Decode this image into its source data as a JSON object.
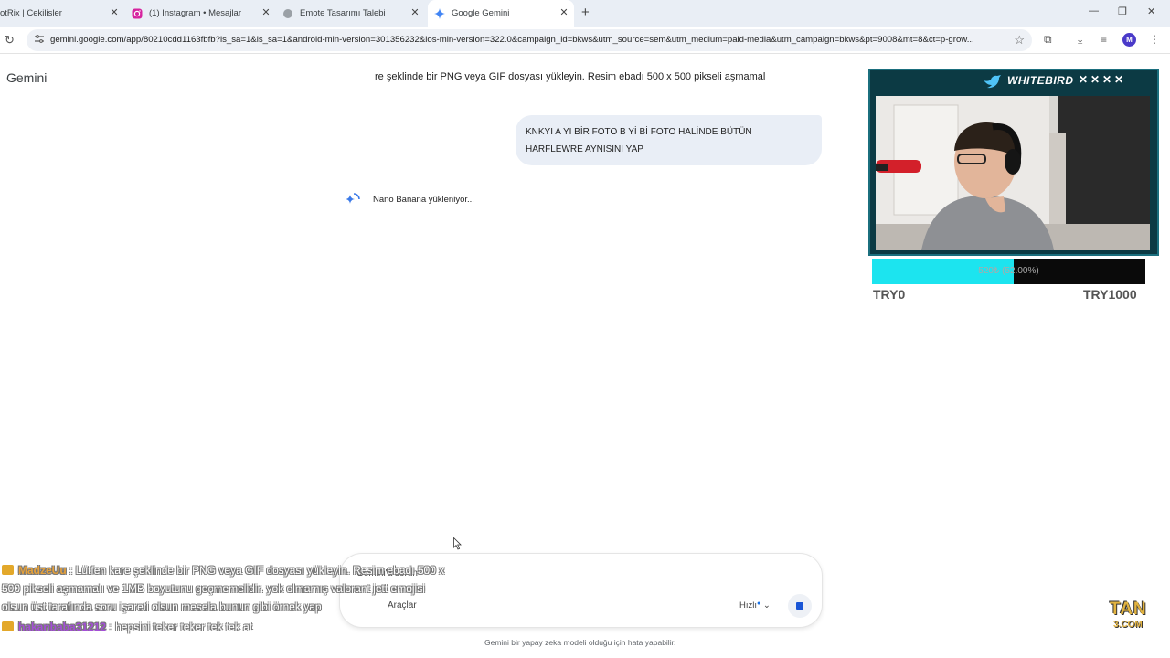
{
  "browser": {
    "tabs": [
      {
        "title": "otRix | Cekilisler",
        "icon": "tab-favicon"
      },
      {
        "title": "(1) Instagram • Mesajlar",
        "icon": "instagram-icon"
      },
      {
        "title": "Emote Tasarımı Talebi",
        "icon": "globe-icon"
      },
      {
        "title": "Google Gemini",
        "icon": "gemini-icon"
      }
    ],
    "url": "gemini.google.com/app/80210cdd1163fbfb?is_sa=1&is_sa=1&android-min-version=301356232&ios-min-version=322.0&campaign_id=bkws&utm_source=sem&utm_medium=paid-media&utm_campaign=bkws&pt=9008&mt=8&ct=p-grow...",
    "profile_initial": "M"
  },
  "gemini": {
    "title": "Gemini",
    "prev_response_tail": "re şeklinde bir PNG veya GIF dosyası yükleyin. Resim ebadı 500 x 500 pikseli aşmamal",
    "user_message_line1": "KNKYI A YI BİR FOTO B Yİ Bİ FOTO HALİNDE BÜTÜN",
    "user_message_line2": "HARFLEWRE AYNISINI YAP",
    "loading_text": "Nano Banana yükleniyor...",
    "input_prompt": "Gemini'a sorun",
    "tools_label": "Araçlar",
    "speed_label": "Hızlı",
    "disclaimer": "Gemini bir yapay zeka modeli olduğu için hata yapabilir."
  },
  "overlay": {
    "webcam_brand": "WHITEBIRD",
    "goal_text": "520₺ (52.00%)",
    "goal_fraction": 0.52,
    "goal_min": "TRY0",
    "goal_max": "TRY1000",
    "chat": [
      {
        "user": "MadzeUu",
        "text": ": Lütfen kare şeklinde bir PNG veya GIF dosyası yükleyin. Resim ebadı 500 x 500 pikseli aşmamalı ve 1MB boyutunu geçmemelidir. yok olmamış valorant jett emojisi olsun üst tarafında soru işareti olsun mesela bunun gibi örnek yap"
      },
      {
        "user": "hakanbaba31212",
        "text": ": hepsini teker teker tek tek at"
      }
    ],
    "logo_top": "TAN",
    "logo_bottom": "3.COM"
  },
  "colors": {
    "accent": "#1a73e8",
    "goal_fill": "#1ce4ef",
    "webcam_frame": "#1b6f7e"
  }
}
